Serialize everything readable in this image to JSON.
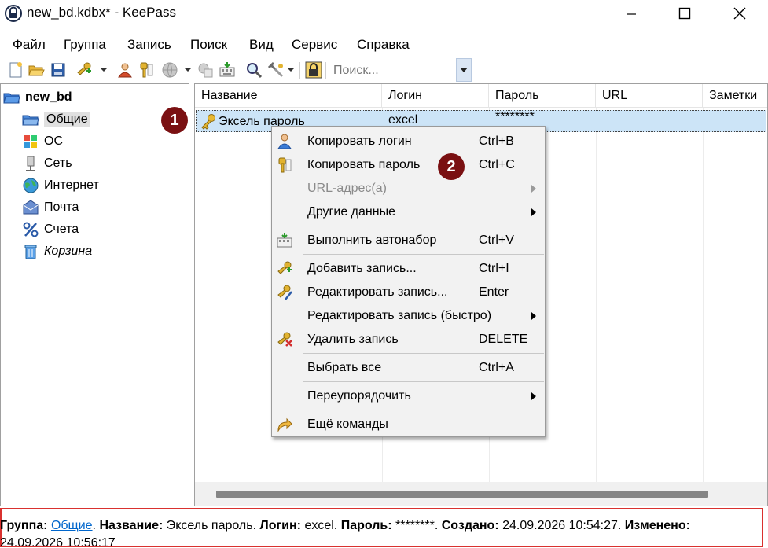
{
  "window": {
    "title": "new_bd.kdbx* - KeePass",
    "minimize_glyph": "—",
    "maximize_glyph": "☐",
    "close_glyph": "✕"
  },
  "menu": {
    "items": [
      "Файл",
      "Группа",
      "Запись",
      "Поиск",
      "Вид",
      "Сервис",
      "Справка"
    ]
  },
  "toolbar": {
    "search_placeholder": "Поиск...",
    "icons": [
      "new-db-icon",
      "open-folder-icon",
      "save-icon",
      "add-entry-icon",
      "copy-username-icon",
      "copy-password-icon",
      "open-url-icon",
      "copy-icon",
      "autotype-icon",
      "find-icon",
      "tools-icon",
      "lock-icon"
    ]
  },
  "tree": {
    "root": "new_bd",
    "groups": [
      {
        "label": "Общие",
        "icon": "folder-icon",
        "selected": true
      },
      {
        "label": "ОС",
        "icon": "windows-icon"
      },
      {
        "label": "Сеть",
        "icon": "network-icon"
      },
      {
        "label": "Интернет",
        "icon": "globe-icon"
      },
      {
        "label": "Почта",
        "icon": "mail-icon"
      },
      {
        "label": "Счета",
        "icon": "percent-icon"
      },
      {
        "label": "Корзина",
        "icon": "recycle-bin-icon",
        "italic": true
      }
    ]
  },
  "list": {
    "columns": [
      "Название",
      "Логин",
      "Пароль",
      "URL",
      "Заметки"
    ],
    "rows": [
      {
        "title": "Эксель пароль",
        "login": "excel",
        "password": "********",
        "url": "",
        "notes": ""
      }
    ]
  },
  "badges": {
    "one": "1",
    "two": "2"
  },
  "context_menu": {
    "items": [
      {
        "label": "Копировать логин",
        "shortcut": "Ctrl+B",
        "icon": "user-icon"
      },
      {
        "label": "Копировать пароль",
        "shortcut": "Ctrl+C",
        "icon": "key-icon"
      },
      {
        "label": "URL-адрес(а)",
        "shortcut": "",
        "disabled": true,
        "submenu": true
      },
      {
        "label": "Другие данные",
        "shortcut": "",
        "submenu": true
      },
      {
        "label": "Выполнить автонабор",
        "shortcut": "Ctrl+V",
        "icon": "autotype-icon"
      },
      {
        "label": "Добавить запись...",
        "shortcut": "Ctrl+I",
        "icon": "add-entry-icon"
      },
      {
        "label": "Редактировать запись...",
        "shortcut": "Enter",
        "icon": "edit-entry-icon"
      },
      {
        "label": "Редактировать запись (быстро)",
        "shortcut": "",
        "submenu": true
      },
      {
        "label": "Удалить запись",
        "shortcut": "DELETE",
        "icon": "delete-entry-icon"
      },
      {
        "label": "Выбрать все",
        "shortcut": "Ctrl+A"
      },
      {
        "label": "Переупорядочить",
        "shortcut": "",
        "submenu": true
      },
      {
        "label": "Ещё команды",
        "shortcut": "",
        "icon": "more-commands-icon"
      }
    ]
  },
  "status": {
    "group_label": "Группа:",
    "group_value": "Общие",
    "title_label": "Название:",
    "title_value": "Эксель пароль.",
    "login_label": "Логин:",
    "login_value": "excel.",
    "password_label": "Пароль:",
    "password_value": "********.",
    "created_label": "Создано:",
    "created_value": "24.09.2026 10:54:27.",
    "modified_label": "Изменено:",
    "modified_value": "24.09.2026 10:56:17"
  },
  "colors": {
    "selection": "#cce4f7",
    "badge": "#7a1012",
    "highlight_frame": "#d9312f",
    "link": "#0066cc"
  }
}
